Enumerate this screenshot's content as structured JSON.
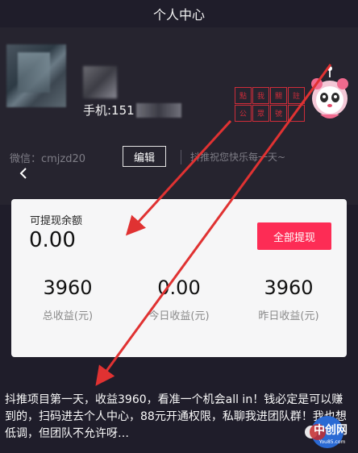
{
  "header": {
    "title": "个人中心"
  },
  "profile": {
    "phone_label": "手机:151",
    "stamp_chars": [
      "點",
      "我",
      "關",
      "註",
      "公",
      "眾",
      "號",
      ""
    ],
    "wechat": "微信：cmjzd20",
    "edit_label": "编辑",
    "motto": "抖推祝您快乐每一天~"
  },
  "balance_card": {
    "withdrawable_label": "可提现余额",
    "withdrawable_value": "0.00",
    "withdraw_button": "全部提现",
    "stats": [
      {
        "value": "3960",
        "label": "总收益(元)"
      },
      {
        "value": "0.00",
        "label": "今日收益(元)"
      },
      {
        "value": "3960",
        "label": "昨日收益(元)"
      }
    ]
  },
  "caption": {
    "text": "抖推项目第一天，收益3960，看准一个机会all in！钱必定是可以赚到的，扫码进去个人中心，88元开通权限，私聊我进团队群！我也想低调，但团队不允许呀…"
  },
  "watermark": {
    "brand": "中创网",
    "url": "You85.com"
  },
  "colors": {
    "background": "#1f1d2a",
    "accent_red": "#fd2c55",
    "arrow_red": "#e03232"
  }
}
